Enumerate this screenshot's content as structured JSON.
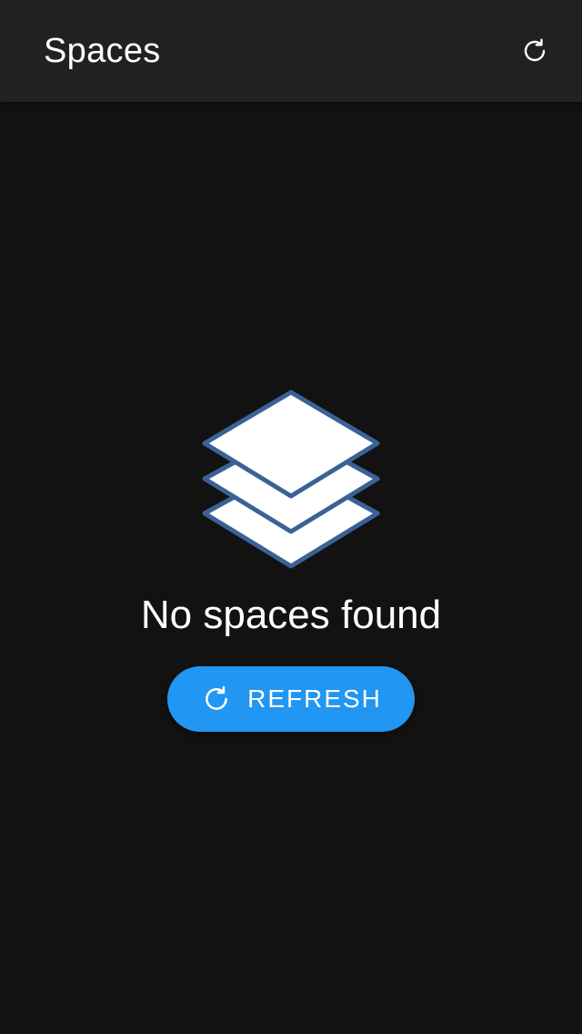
{
  "app_bar": {
    "title": "Spaces",
    "refresh_icon": "refresh-icon"
  },
  "empty_state": {
    "icon": "layers-icon",
    "message": "No spaces found",
    "button": {
      "icon": "refresh-icon",
      "label": "REFRESH"
    }
  },
  "colors": {
    "background": "#121212",
    "app_bar": "#212121",
    "accent": "#2196f3",
    "icon_stroke": "#3b6296",
    "text": "#ffffff"
  }
}
